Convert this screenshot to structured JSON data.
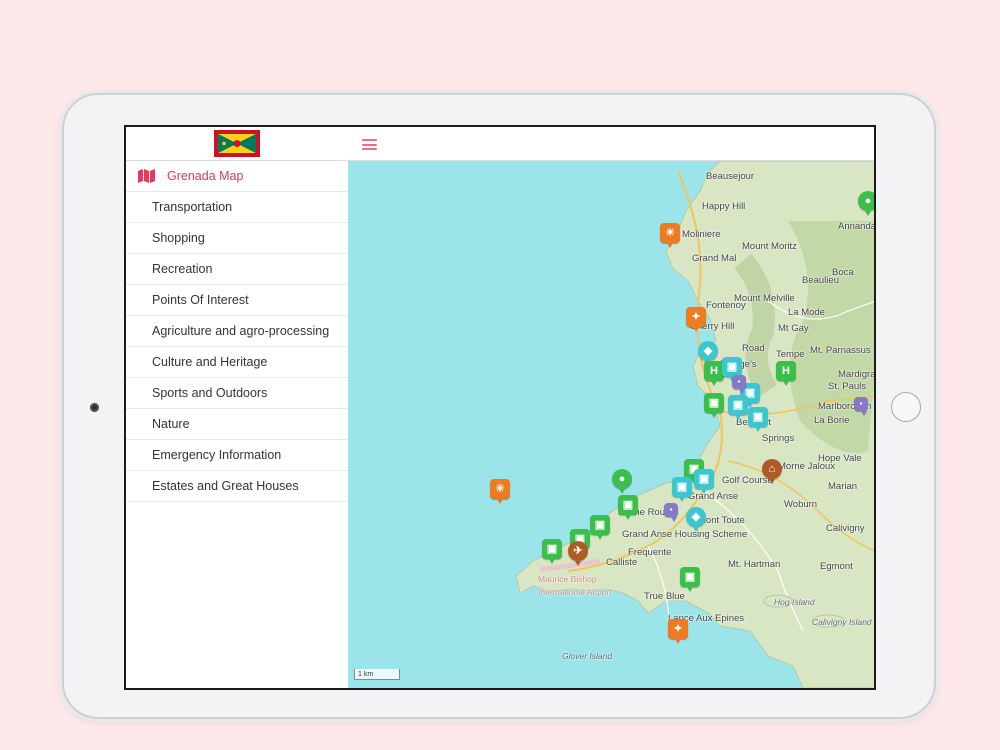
{
  "app": {
    "brand_color": "#e8375a",
    "flag_colors": {
      "red": "#ce1126",
      "yellow": "#fcd116",
      "green": "#007a5e"
    }
  },
  "sidebar": {
    "title": "Grenada Map",
    "items": [
      {
        "label": "Transportation"
      },
      {
        "label": "Shopping"
      },
      {
        "label": "Recreation"
      },
      {
        "label": "Points Of Interest"
      },
      {
        "label": "Agriculture and agro-processing"
      },
      {
        "label": "Culture and Heritage"
      },
      {
        "label": "Sports and Outdoors"
      },
      {
        "label": "Nature"
      },
      {
        "label": "Emergency Information"
      },
      {
        "label": "Estates and Great Houses"
      }
    ]
  },
  "map": {
    "scale_label": "1 km",
    "places": [
      {
        "name": "Beausejour"
      },
      {
        "name": "Happy Hill"
      },
      {
        "name": "Moliniere"
      },
      {
        "name": "Mount Moritz"
      },
      {
        "name": "Grand Mal"
      },
      {
        "name": "Boca"
      },
      {
        "name": "Beaulieu"
      },
      {
        "name": "Annandale"
      },
      {
        "name": "Mount Melville"
      },
      {
        "name": "Fontenoy"
      },
      {
        "name": "La Mode"
      },
      {
        "name": "Cherry Hill"
      },
      {
        "name": "Mt Gay"
      },
      {
        "name": "Road"
      },
      {
        "name": "Tempe"
      },
      {
        "name": "Mt. Parnassus"
      },
      {
        "name": "St. George's"
      },
      {
        "name": "Mardigras"
      },
      {
        "name": "St. Pauls"
      },
      {
        "name": "Marlborough"
      },
      {
        "name": "Belmont"
      },
      {
        "name": "Springs"
      },
      {
        "name": "La Borie"
      },
      {
        "name": "Hope Vale"
      },
      {
        "name": "Morne Jaloux"
      },
      {
        "name": "Marian"
      },
      {
        "name": "Golf Course"
      },
      {
        "name": "Grand Anse"
      },
      {
        "name": "Woburn"
      },
      {
        "name": "Morne Rouge"
      },
      {
        "name": "Mont Toute"
      },
      {
        "name": "Grand Anse Housing Scheme"
      },
      {
        "name": "Calivigny"
      },
      {
        "name": "Frequente"
      },
      {
        "name": "Calliste"
      },
      {
        "name": "Mt. Hartman"
      },
      {
        "name": "Egmont"
      },
      {
        "name": "Maurice Bishop International Airport"
      },
      {
        "name": "True Blue"
      },
      {
        "name": "Hog Island"
      },
      {
        "name": "Lance Aux Epines"
      },
      {
        "name": "Calivigny Island"
      },
      {
        "name": "Glover Island"
      }
    ]
  }
}
